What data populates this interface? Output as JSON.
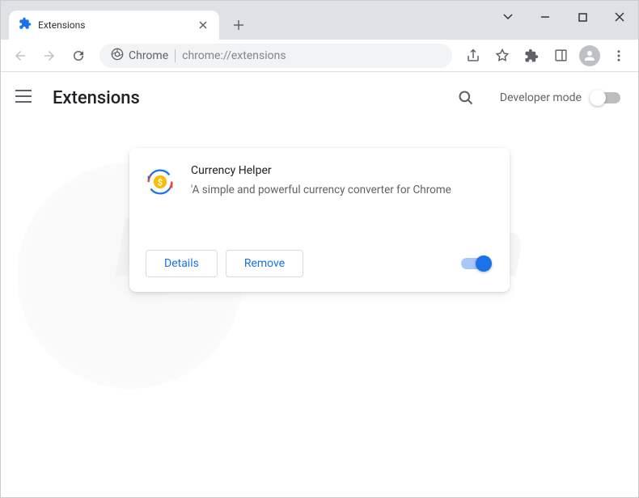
{
  "window": {
    "tab_title": "Extensions"
  },
  "omnibox": {
    "chrome_label": "Chrome",
    "url": "chrome://extensions"
  },
  "header": {
    "title": "Extensions",
    "dev_mode_label": "Developer mode",
    "dev_mode_on": false
  },
  "extension": {
    "name": "Currency Helper",
    "description": "'A simple and powerful currency converter for Chrome",
    "details_label": "Details",
    "remove_label": "Remove",
    "enabled": true
  },
  "watermark": "PCrisk.com"
}
